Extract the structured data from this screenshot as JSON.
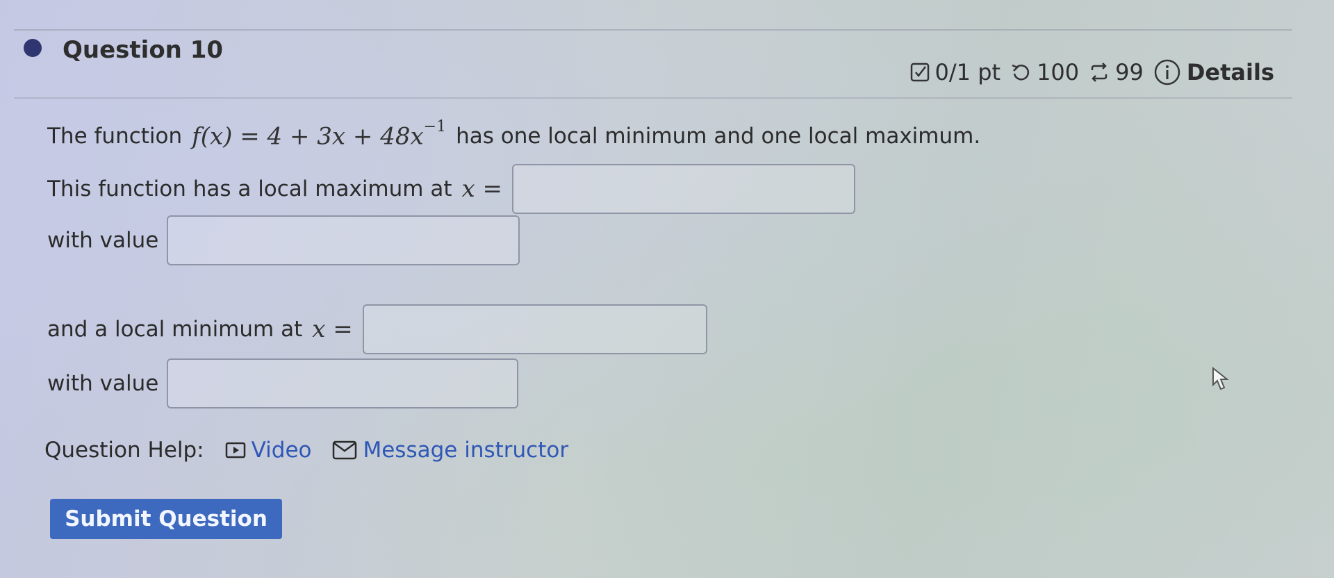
{
  "question": {
    "title": "Question 10",
    "score": "0/1 pt",
    "retries": "100",
    "attempts": "99",
    "details_label": "Details"
  },
  "problem": {
    "intro_prefix": "The function",
    "function_expr": "f(x) = 4 + 3x + 48x",
    "function_exponent": "−1",
    "intro_suffix": "has one local minimum and one local maximum.",
    "max_prompt": "This function has a local maximum at",
    "min_prompt": "and a local minimum at",
    "x_equals": "x =",
    "with_value": "with value"
  },
  "answers": {
    "max_x": "",
    "max_value": "",
    "min_x": "",
    "min_value": ""
  },
  "help": {
    "label": "Question Help:",
    "video_label": "Video",
    "message_label": "Message instructor"
  },
  "submit_label": "Submit Question",
  "icons": {
    "score": "checkbox-icon",
    "retries": "undo-icon",
    "attempts": "repeat-icon",
    "details": "info-icon",
    "video": "play-icon",
    "message": "mail-icon",
    "bullet": "circle-icon",
    "cursor": "pointer-cursor-icon"
  },
  "colors": {
    "accent": "#3d69bf",
    "link": "#2f57b6",
    "bullet": "#2e3570"
  }
}
